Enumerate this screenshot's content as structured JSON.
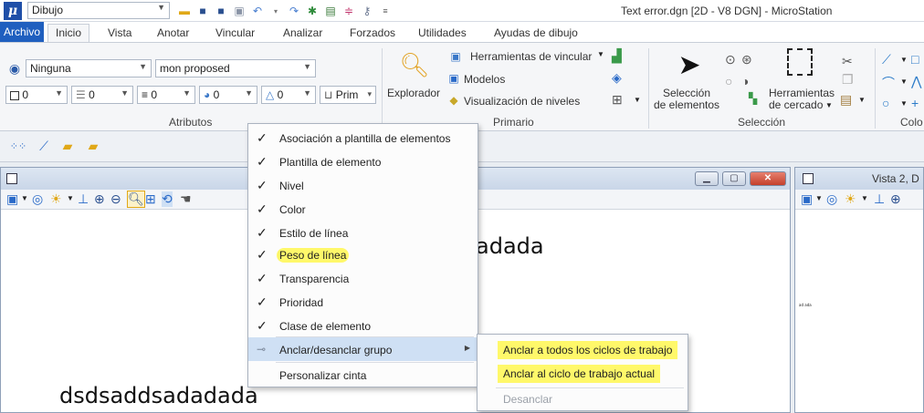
{
  "app": {
    "logo_letter": "μ",
    "workflow": "Dibujo",
    "window_title": "Text error.dgn [2D - V8 DGN] - MicroStation"
  },
  "tabs": [
    "Archivo",
    "Inicio",
    "Vista",
    "Anotar",
    "Vincular",
    "Analizar",
    "Forzados",
    "Utilidades",
    "Ayudas de dibujo"
  ],
  "ribbon": {
    "attributes": {
      "level": "Ninguna",
      "template": "mon proposed",
      "color_value": "0",
      "style_value": "0",
      "weight_value": "0",
      "transparency_value": "0",
      "priority_value": "0",
      "class_value": "Prim",
      "label": "Atributos"
    },
    "primary": {
      "explorer": "Explorador",
      "link_tools": "Herramientas de vincular",
      "models": "Modelos",
      "level_display": "Visualización de niveles",
      "label": "Primario"
    },
    "selection": {
      "element_selection_line1": "Selección",
      "element_selection_line2": "de elementos",
      "fence_tools_line1": "Herramientas",
      "fence_tools_line2": "de cercado",
      "label": "Selección"
    },
    "color_label_partial": "Colo"
  },
  "views": {
    "view1_text_a": "adada",
    "view1_text_b": "dsdsaddsadadada",
    "view2_title_partial": "Vista 2, D",
    "view2_tiny_text": "ad ada"
  },
  "context_menu": {
    "items": [
      {
        "label": "Asociación a plantilla de elementos",
        "checked": true
      },
      {
        "label": "Plantilla de elemento",
        "checked": true
      },
      {
        "label": "Nivel",
        "checked": true
      },
      {
        "label": "Color",
        "checked": true
      },
      {
        "label": "Estilo de línea",
        "checked": true
      },
      {
        "label": "Peso de línea",
        "checked": true,
        "highlighted": true
      },
      {
        "label": "Transparencia",
        "checked": true
      },
      {
        "label": "Prioridad",
        "checked": true
      },
      {
        "label": "Clase de elemento",
        "checked": true
      }
    ],
    "pin_group": "Anclar/desanclar grupo",
    "customize": "Personalizar cinta"
  },
  "submenu": {
    "pin_all": "Anclar a todos los ciclos de trabajo",
    "pin_current": "Anclar al ciclo de trabajo actual",
    "unpin": "Desanclar"
  },
  "colors": {
    "file_tab": "#1f5fbf",
    "highlight": "#fff86a",
    "menu_hover": "#cfe0f4",
    "close_button": "#c4402c"
  },
  "check_mark": "✓"
}
